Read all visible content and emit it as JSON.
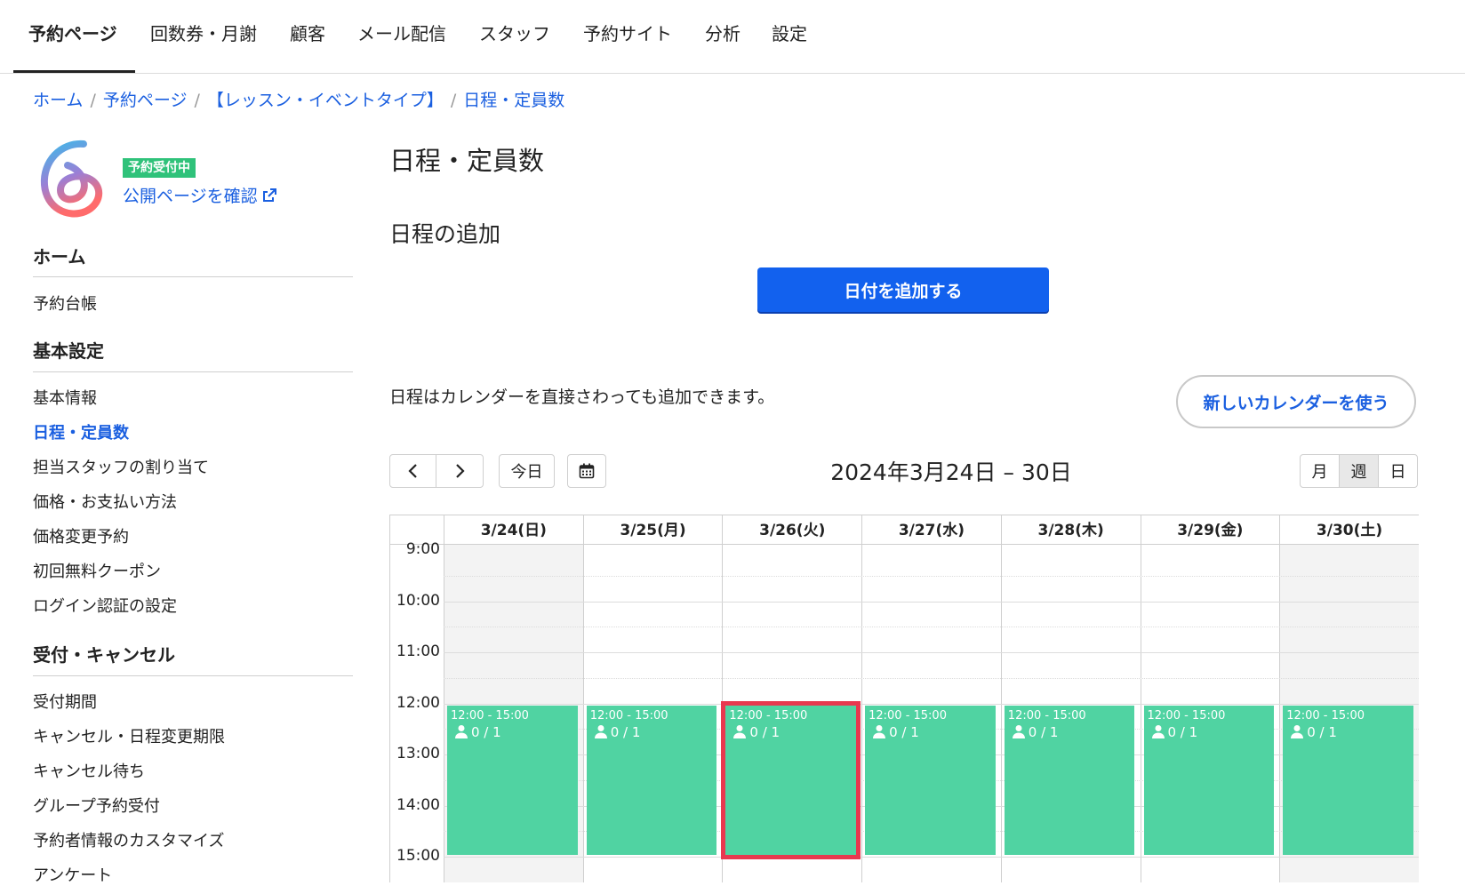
{
  "nav": {
    "items": [
      "予約ページ",
      "回数券・月謝",
      "顧客",
      "メール配信",
      "スタッフ",
      "予約サイト",
      "分析",
      "設定"
    ],
    "active_index": 0
  },
  "breadcrumb": {
    "items": [
      "ホーム",
      "予約ページ",
      "【レッスン・イベントタイプ】",
      "日程・定員数"
    ]
  },
  "sidebar": {
    "status_badge": "予約受付中",
    "public_link": "公開ページを確認",
    "sections": [
      {
        "heading": "ホーム",
        "items": [
          "予約台帳"
        ]
      },
      {
        "heading": "基本設定",
        "items": [
          "基本情報",
          "日程・定員数",
          "担当スタッフの割り当て",
          "価格・お支払い方法",
          "価格変更予約",
          "初回無料クーポン",
          "ログイン認証の設定"
        ]
      },
      {
        "heading": "受付・キャンセル",
        "items": [
          "受付期間",
          "キャンセル・日程変更期限",
          "キャンセル待ち",
          "グループ予約受付",
          "予約者情報のカスタマイズ",
          "アンケート"
        ]
      }
    ],
    "active_item": "日程・定員数"
  },
  "main": {
    "page_title": "日程・定員数",
    "section_title": "日程の追加",
    "add_date_button": "日付を追加する",
    "hint": "日程はカレンダーを直接さわっても追加できます。",
    "new_calendar_button": "新しいカレンダーを使う"
  },
  "calendar": {
    "today_button": "今日",
    "range_title": "2024年3月24日 – 30日",
    "view_buttons": [
      "月",
      "週",
      "日"
    ],
    "active_view": "週",
    "days": [
      "3/24(日)",
      "3/25(月)",
      "3/26(火)",
      "3/27(水)",
      "3/28(木)",
      "3/29(金)",
      "3/30(土)"
    ],
    "weekend_indices": [
      0,
      6
    ],
    "time_labels": [
      "9:00",
      "10:00",
      "11:00",
      "12:00",
      "13:00",
      "14:00",
      "15:00"
    ],
    "events": [
      {
        "day": 0,
        "time": "12:00 - 15:00",
        "count": "0 / 1",
        "selected": false
      },
      {
        "day": 1,
        "time": "12:00 - 15:00",
        "count": "0 / 1",
        "selected": false
      },
      {
        "day": 2,
        "time": "12:00 - 15:00",
        "count": "0 / 1",
        "selected": true
      },
      {
        "day": 3,
        "time": "12:00 - 15:00",
        "count": "0 / 1",
        "selected": false
      },
      {
        "day": 4,
        "time": "12:00 - 15:00",
        "count": "0 / 1",
        "selected": false
      },
      {
        "day": 5,
        "time": "12:00 - 15:00",
        "count": "0 / 1",
        "selected": false
      },
      {
        "day": 6,
        "time": "12:00 - 15:00",
        "count": "0 / 1",
        "selected": false
      }
    ]
  },
  "colors": {
    "accent": "#1261ee",
    "link": "#1a5fe0",
    "event": "#50d3a2",
    "badge": "#2fc27a",
    "selected_outline": "#e8384f"
  }
}
